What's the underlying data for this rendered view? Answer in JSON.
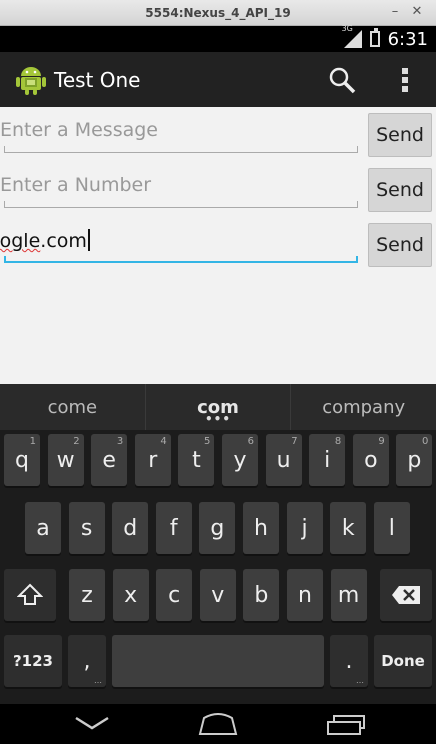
{
  "emulator": {
    "title": "5554:Nexus_4_API_19",
    "minimize": "–",
    "close": "✕"
  },
  "status_bar": {
    "network": "3G",
    "time": "6:31"
  },
  "action_bar": {
    "title": "Test One"
  },
  "rows": [
    {
      "placeholder": "Enter a Message",
      "value": "",
      "button": "Send"
    },
    {
      "placeholder": "Enter a Number",
      "value": "",
      "button": "Send"
    },
    {
      "placeholder": "",
      "value_prefix": "oogle",
      "value_suffix": ".com",
      "button": "Send"
    }
  ],
  "keyboard": {
    "suggestions": [
      "come",
      "com",
      "company"
    ],
    "row1": [
      {
        "k": "q",
        "h": "1"
      },
      {
        "k": "w",
        "h": "2"
      },
      {
        "k": "e",
        "h": "3"
      },
      {
        "k": "r",
        "h": "4"
      },
      {
        "k": "t",
        "h": "5"
      },
      {
        "k": "y",
        "h": "6"
      },
      {
        "k": "u",
        "h": "7"
      },
      {
        "k": "i",
        "h": "8"
      },
      {
        "k": "o",
        "h": "9"
      },
      {
        "k": "p",
        "h": "0"
      }
    ],
    "row2": [
      "a",
      "s",
      "d",
      "f",
      "g",
      "h",
      "j",
      "k",
      "l"
    ],
    "row3": [
      "z",
      "x",
      "c",
      "v",
      "b",
      "n",
      "m"
    ],
    "symbols": "?123",
    "comma": ",",
    "period": ".",
    "done": "Done"
  }
}
